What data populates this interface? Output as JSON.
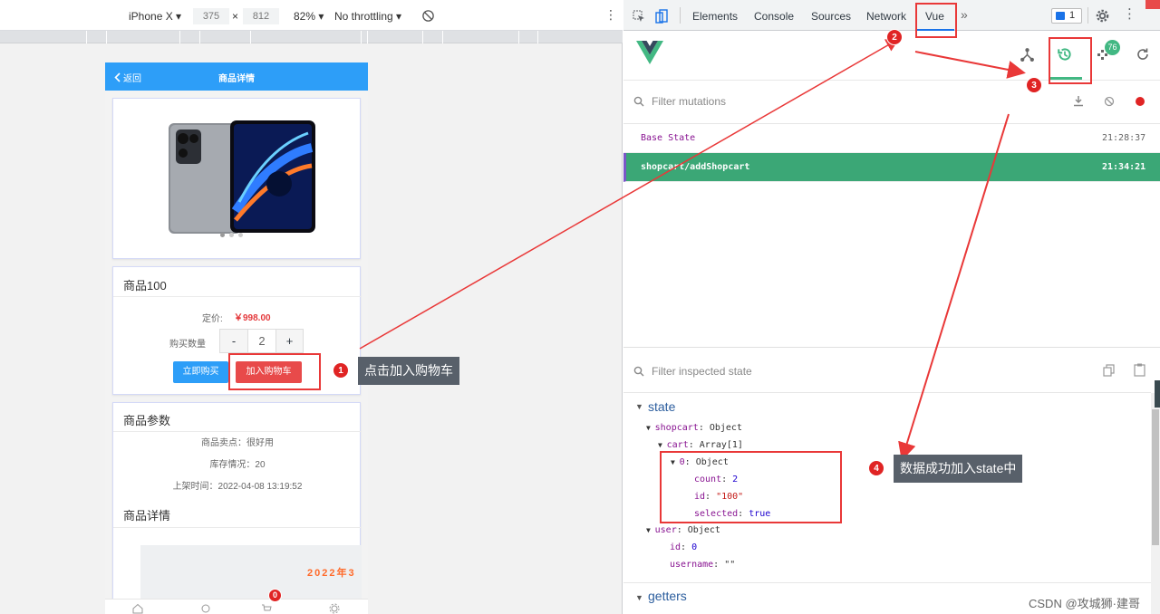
{
  "devtoolbar": {
    "device": "iPhone X",
    "width": "375",
    "sep": "×",
    "height": "812",
    "zoom": "82%",
    "throttle": "No throttling"
  },
  "phone": {
    "nav_back": "返回",
    "nav_title": "商品详情",
    "product_title": "商品100",
    "price_label": "定价:",
    "price_value": "￥998.00",
    "qty_label": "购买数量",
    "qty_minus": "-",
    "qty_value": "2",
    "qty_plus": "+",
    "buy_now": "立即购买",
    "add_cart": "加入购物车",
    "params_title": "商品参数",
    "sell_point": "商品卖点：很好用",
    "stock": "库存情况：20",
    "release": "上架时间：2022-04-08 13:19:52",
    "detail_title": "商品详情",
    "banner_text": "2022年3",
    "cart_badge": "0"
  },
  "devtools": {
    "tabs": [
      "Elements",
      "Console",
      "Sources",
      "Network",
      "Vue"
    ],
    "more": "»",
    "issues": "1",
    "vue_badge": "76",
    "filter_mutations": "Filter mutations",
    "mutations": [
      {
        "name": "Base State",
        "time": "21:28:37"
      },
      {
        "name": "shopcart/addShopcart",
        "time": "21:34:21"
      }
    ],
    "filter_state": "Filter inspected state",
    "state_section": "state",
    "getters_section": "getters",
    "tree": {
      "shopcart": "shopcart",
      "shopcart_type": ": Object",
      "cart": "cart",
      "cart_type": ": Array[1]",
      "item0": "0",
      "item0_type": ": Object",
      "count_k": "count",
      "count_v": "2",
      "id_k": "id",
      "id_v": "\"100\"",
      "selected_k": "selected",
      "selected_v": "true",
      "user": "user",
      "user_type": ": Object",
      "uid_k": "id",
      "uid_v": "0",
      "uname_k": "username",
      "uname_v": "\"\""
    }
  },
  "annotations": {
    "n1": "1",
    "tip1": "点击加入购物车",
    "n2": "2",
    "n3": "3",
    "n4": "4",
    "tip4": "数据成功加入state中"
  },
  "watermark": "CSDN @攻城狮·建哥",
  "colors": {
    "vue_green": "#42b883",
    "selected_row": "#3ba776",
    "nav_blue": "#2d9ef8",
    "annotation_red": "#e93838"
  }
}
